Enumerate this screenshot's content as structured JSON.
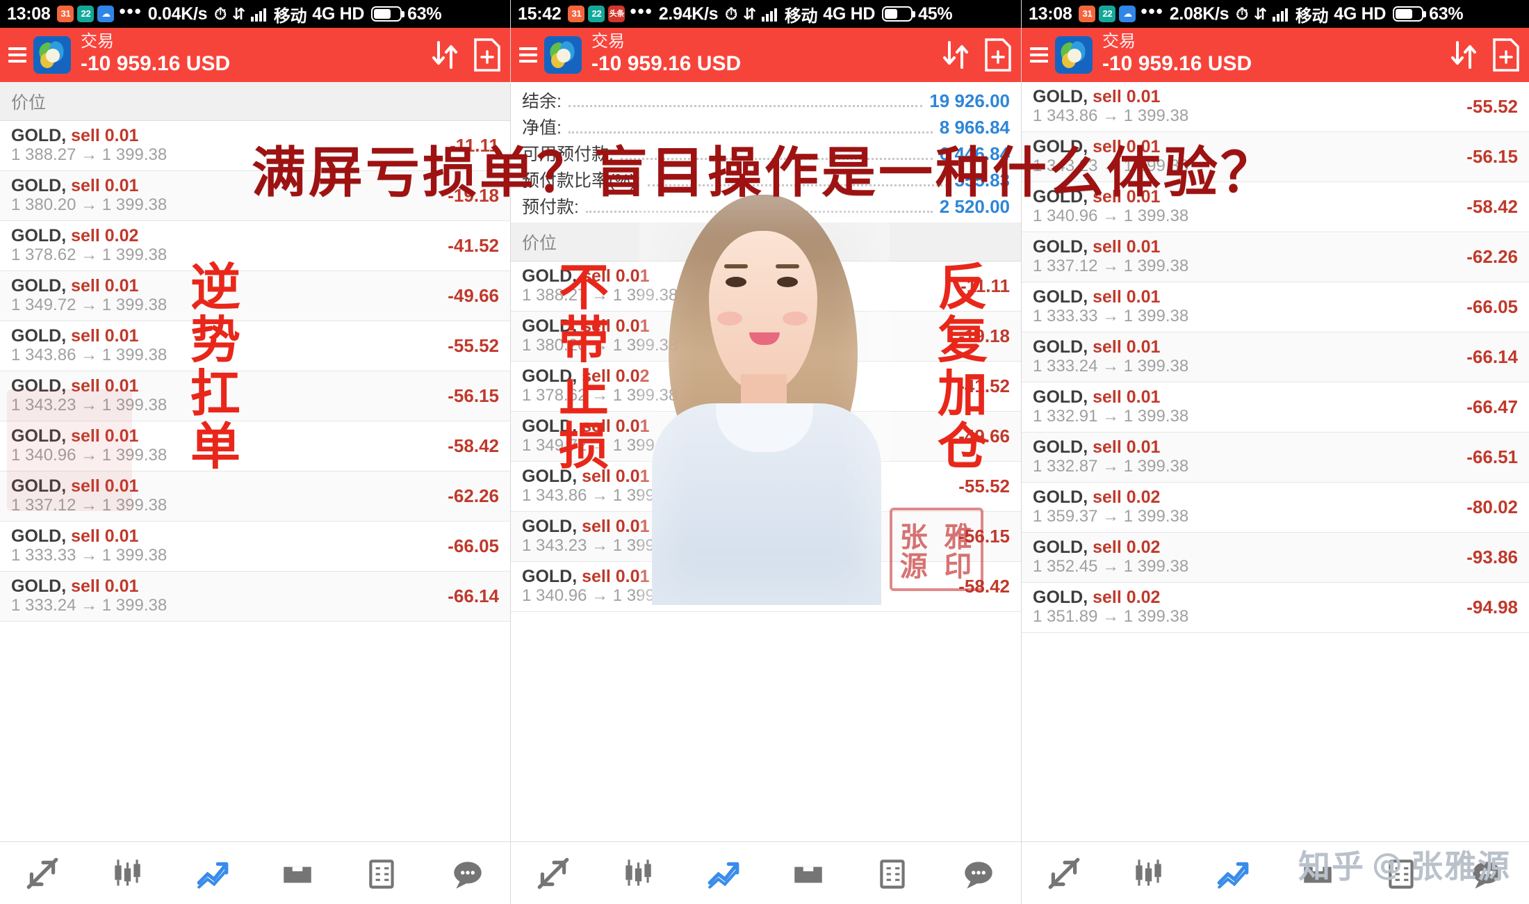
{
  "panels": [
    {
      "status": {
        "time": "13:08",
        "speed": "0.04K/s",
        "carrier": "移动",
        "network": "4G HD",
        "battery": "63%",
        "icons": [
          "calendar-icon",
          "22-icon",
          "cloud-icon",
          "more-dots-icon",
          "alarm-icon",
          "data-transfer-icon",
          "signal-icon",
          "battery-icon"
        ]
      },
      "appbar": {
        "title": "交易",
        "balance": "-10 959.16 USD",
        "menu_icon": "hamburger-icon",
        "sort_icon": "sort-arrows-icon",
        "new_order_icon": "new-order-icon"
      },
      "column_header": "价位",
      "rows": [
        {
          "symbol": "GOLD,",
          "side": "sell 0.01",
          "open": "1 388.27",
          "close": "1 399.38",
          "pl": "-11.11"
        },
        {
          "symbol": "GOLD,",
          "side": "sell 0.01",
          "open": "1 380.20",
          "close": "1 399.38",
          "pl": "-19.18"
        },
        {
          "symbol": "GOLD,",
          "side": "sell 0.02",
          "open": "1 378.62",
          "close": "1 399.38",
          "pl": "-41.52"
        },
        {
          "symbol": "GOLD,",
          "side": "sell 0.01",
          "open": "1 349.72",
          "close": "1 399.38",
          "pl": "-49.66"
        },
        {
          "symbol": "GOLD,",
          "side": "sell 0.01",
          "open": "1 343.86",
          "close": "1 399.38",
          "pl": "-55.52"
        },
        {
          "symbol": "GOLD,",
          "side": "sell 0.01",
          "open": "1 343.23",
          "close": "1 399.38",
          "pl": "-56.15"
        },
        {
          "symbol": "GOLD,",
          "side": "sell 0.01",
          "open": "1 340.96",
          "close": "1 399.38",
          "pl": "-58.42"
        },
        {
          "symbol": "GOLD,",
          "side": "sell 0.01",
          "open": "1 337.12",
          "close": "1 399.38",
          "pl": "-62.26"
        },
        {
          "symbol": "GOLD,",
          "side": "sell 0.01",
          "open": "1 333.33",
          "close": "1 399.38",
          "pl": "-66.05"
        },
        {
          "symbol": "GOLD,",
          "side": "sell 0.01",
          "open": "1 333.24",
          "close": "1 399.38",
          "pl": "-66.14"
        }
      ],
      "vertical_label": "逆势扛单"
    },
    {
      "status": {
        "time": "15:42",
        "speed": "2.94K/s",
        "carrier": "移动",
        "network": "4G HD",
        "battery": "45%",
        "icons": [
          "calendar-icon",
          "22-icon",
          "news-icon",
          "more-dots-icon",
          "alarm-icon",
          "data-transfer-icon",
          "signal-icon",
          "battery-icon"
        ]
      },
      "appbar": {
        "title": "交易",
        "balance": "-10 959.16 USD",
        "menu_icon": "hamburger-icon",
        "sort_icon": "sort-arrows-icon",
        "new_order_icon": "new-order-icon"
      },
      "account": [
        {
          "label": "结余:",
          "value": "19 926.00"
        },
        {
          "label": "净值:",
          "value": "8 966.84"
        },
        {
          "label": "可用预付款:",
          "value": "6 446.84"
        },
        {
          "label": "预付款比率(%):",
          "value": "355.83"
        },
        {
          "label": "预付款:",
          "value": "2 520.00"
        }
      ],
      "column_header": "价位",
      "rows": [
        {
          "symbol": "GOLD,",
          "side": "sell 0.01",
          "open": "1 388.27",
          "close": "1 399.38",
          "pl": "-11.11"
        },
        {
          "symbol": "GOLD,",
          "side": "sell 0.01",
          "open": "1 380.20",
          "close": "1 399.38",
          "pl": "-19.18"
        },
        {
          "symbol": "GOLD,",
          "side": "sell 0.02",
          "open": "1 378.62",
          "close": "1 399.38",
          "pl": "-41.52"
        },
        {
          "symbol": "GOLD,",
          "side": "sell 0.01",
          "open": "1 349.72",
          "close": "1 399.38",
          "pl": "-49.66"
        },
        {
          "symbol": "GOLD,",
          "side": "sell 0.01",
          "open": "1 343.86",
          "close": "1 399.38",
          "pl": "-55.52"
        },
        {
          "symbol": "GOLD,",
          "side": "sell 0.01",
          "open": "1 343.23",
          "close": "1 399.38",
          "pl": "-56.15"
        },
        {
          "symbol": "GOLD,",
          "side": "sell 0.01",
          "open": "1 340.96",
          "close": "1 399.38",
          "pl": "-58.42"
        }
      ],
      "vertical_label": "不带止损",
      "stamp_text": "张雅源印"
    },
    {
      "status": {
        "time": "13:08",
        "speed": "2.08K/s",
        "carrier": "移动",
        "network": "4G HD",
        "battery": "63%",
        "icons": [
          "calendar-icon",
          "22-icon",
          "cloud-icon",
          "more-dots-icon",
          "alarm-icon",
          "data-transfer-icon",
          "signal-icon",
          "battery-icon"
        ]
      },
      "appbar": {
        "title": "交易",
        "balance": "-10 959.16 USD",
        "menu_icon": "hamburger-icon",
        "sort_icon": "sort-arrows-icon",
        "new_order_icon": "new-order-icon"
      },
      "rows": [
        {
          "symbol": "GOLD,",
          "side": "sell 0.01",
          "open": "1 343.86",
          "close": "1 399.38",
          "pl": "-55.52"
        },
        {
          "symbol": "GOLD,",
          "side": "sell 0.01",
          "open": "1 343.23",
          "close": "1 399.38",
          "pl": "-56.15"
        },
        {
          "symbol": "GOLD,",
          "side": "sell 0.01",
          "open": "1 340.96",
          "close": "1 399.38",
          "pl": "-58.42"
        },
        {
          "symbol": "GOLD,",
          "side": "sell 0.01",
          "open": "1 337.12",
          "close": "1 399.38",
          "pl": "-62.26"
        },
        {
          "symbol": "GOLD,",
          "side": "sell 0.01",
          "open": "1 333.33",
          "close": "1 399.38",
          "pl": "-66.05"
        },
        {
          "symbol": "GOLD,",
          "side": "sell 0.01",
          "open": "1 333.24",
          "close": "1 399.38",
          "pl": "-66.14"
        },
        {
          "symbol": "GOLD,",
          "side": "sell 0.01",
          "open": "1 332.91",
          "close": "1 399.38",
          "pl": "-66.47"
        },
        {
          "symbol": "GOLD,",
          "side": "sell 0.01",
          "open": "1 332.87",
          "close": "1 399.38",
          "pl": "-66.51"
        },
        {
          "symbol": "GOLD,",
          "side": "sell 0.02",
          "open": "1 359.37",
          "close": "1 399.38",
          "pl": "-80.02"
        },
        {
          "symbol": "GOLD,",
          "side": "sell 0.02",
          "open": "1 352.45",
          "close": "1 399.38",
          "pl": "-93.86"
        },
        {
          "symbol": "GOLD,",
          "side": "sell 0.02",
          "open": "1 351.89",
          "close": "1 399.38",
          "pl": "-94.98"
        }
      ],
      "vertical_label": "反复加仓"
    }
  ],
  "overlay": {
    "headline": "满屏亏损单？盲目操作是一种什么体验？",
    "headline_color": "#9e1212",
    "vertical_color": "#e8271a"
  },
  "tabbar": {
    "items": [
      {
        "icon": "quotes-arrows-icon",
        "name": "quotes"
      },
      {
        "icon": "candlestick-chart-icon",
        "name": "charts"
      },
      {
        "icon": "trade-trend-icon",
        "name": "trade"
      },
      {
        "icon": "history-inbox-icon",
        "name": "history"
      },
      {
        "icon": "news-list-icon",
        "name": "news"
      },
      {
        "icon": "chat-bubble-icon",
        "name": "messages"
      }
    ]
  },
  "watermark": {
    "site": "知乎",
    "at": "@",
    "user": "张雅源"
  }
}
